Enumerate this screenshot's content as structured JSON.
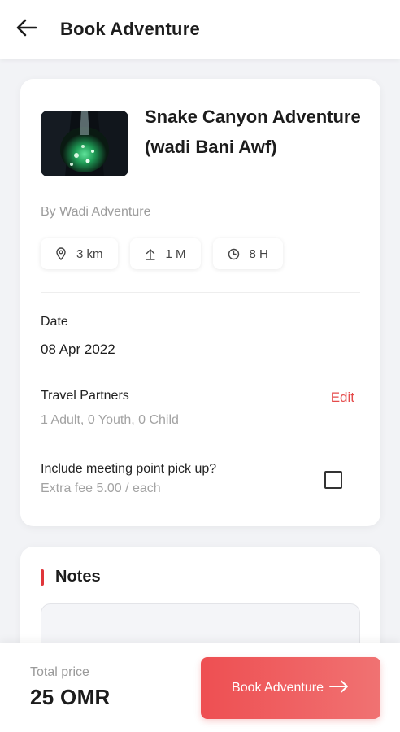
{
  "header": {
    "title": "Book Adventure",
    "back_icon": "arrow-left-icon"
  },
  "trip": {
    "title": "Snake Canyon Adventure (wadi Bani Awf)",
    "provider": "By Wadi Adventure",
    "stats": [
      {
        "icon": "location-pin-icon",
        "value": "3 km"
      },
      {
        "icon": "arrow-up-icon",
        "value": "1 M"
      },
      {
        "icon": "clock-icon",
        "value": "8 H"
      }
    ]
  },
  "booking": {
    "date_label": "Date",
    "date_value": "08 Apr 2022",
    "partners_label": "Travel Partners",
    "partners_value": "1 Adult, 0 Youth, 0 Child",
    "edit_label": "Edit",
    "pickup_label": "Include meeting point pick up?",
    "pickup_fee": "Extra fee 5.00 / each",
    "pickup_checked": false
  },
  "notes": {
    "title": "Notes",
    "placeholder": ""
  },
  "footer": {
    "total_label": "Total price",
    "total_value": "25 OMR",
    "book_button": "Book Adventure"
  },
  "colors": {
    "accent": "#e54b4b",
    "button_start": "#ee4f52",
    "button_end": "#f07272",
    "background": "#f2f3f6"
  }
}
